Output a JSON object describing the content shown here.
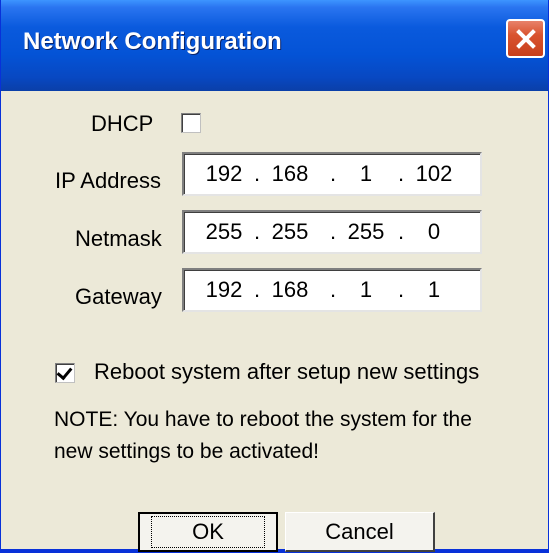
{
  "window": {
    "title": "Network Configuration"
  },
  "form": {
    "dhcp_label": "DHCP",
    "dhcp_checked": false,
    "ip_label": "IP Address",
    "ip": [
      "192",
      "168",
      "1",
      "102"
    ],
    "netmask_label": "Netmask",
    "netmask": [
      "255",
      "255",
      "255",
      "0"
    ],
    "gateway_label": "Gateway",
    "gateway": [
      "192",
      "168",
      "1",
      "1"
    ],
    "separator": ".",
    "reboot_label": "Reboot system after setup new settings",
    "reboot_checked": true,
    "note": "NOTE: You have to reboot the system for the new settings to be activated!"
  },
  "buttons": {
    "ok_label": "OK",
    "cancel_label": "Cancel"
  },
  "icons": {
    "close": "close-icon"
  },
  "colors": {
    "titlebar": "#0453D6",
    "window_bg": "#ECE9D8",
    "close_button": "#D9532F"
  }
}
